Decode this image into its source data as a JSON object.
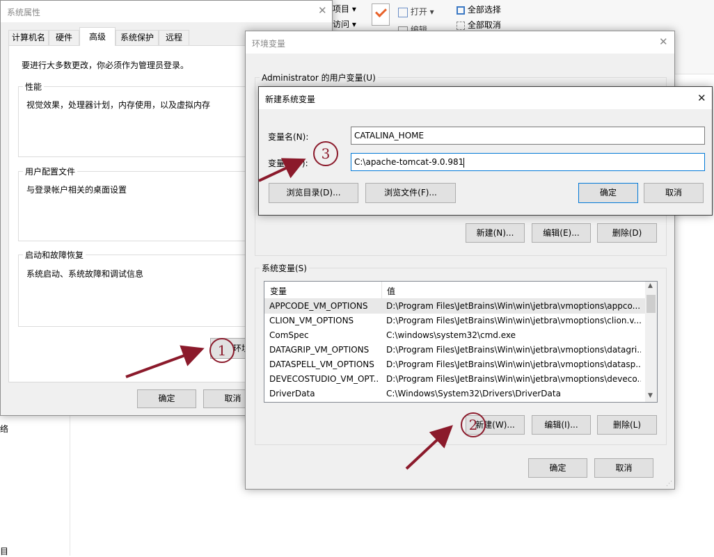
{
  "explorer": {
    "ribbon": {
      "item_project": "项目",
      "item_access": "访问",
      "open": "打开",
      "edit": "编辑",
      "select_all": "全部选择",
      "select_none": "全部取消"
    },
    "left_text_1": "络",
    "left_text_2": "目"
  },
  "sys_props": {
    "title": "系统属性",
    "tabs": [
      "计算机名",
      "硬件",
      "高级",
      "系统保护",
      "远程"
    ],
    "admin_note": "要进行大多数更改，你必须作为管理员登录。",
    "groups": [
      {
        "label": "性能",
        "desc": "视觉效果，处理器计划，内存使用，以及虚拟内存"
      },
      {
        "label": "用户配置文件",
        "desc": "与登录帐户相关的桌面设置"
      },
      {
        "label": "启动和故障恢复",
        "desc": "系统启动、系统故障和调试信息"
      }
    ],
    "env_button": "环境",
    "ok": "确定",
    "cancel": "取消"
  },
  "env_vars": {
    "title": "环境变量",
    "user_group_label": "Administrator 的用户变量(U)",
    "user_buttons": {
      "new": "新建(N)...",
      "edit": "编辑(E)...",
      "delete": "删除(D)"
    },
    "sys_group_label": "系统变量(S)",
    "columns": {
      "name": "变量",
      "value": "值"
    },
    "rows": [
      {
        "name": "APPCODE_VM_OPTIONS",
        "value": "D:\\Program Files\\JetBrains\\Win\\win\\jetbra\\vmoptions\\appco..."
      },
      {
        "name": "CLION_VM_OPTIONS",
        "value": "D:\\Program Files\\JetBrains\\Win\\win\\jetbra\\vmoptions\\clion.v..."
      },
      {
        "name": "ComSpec",
        "value": "C:\\windows\\system32\\cmd.exe"
      },
      {
        "name": "DATAGRIP_VM_OPTIONS",
        "value": "D:\\Program Files\\JetBrains\\Win\\win\\jetbra\\vmoptions\\datagri..."
      },
      {
        "name": "DATASPELL_VM_OPTIONS",
        "value": "D:\\Program Files\\JetBrains\\Win\\win\\jetbra\\vmoptions\\datasp..."
      },
      {
        "name": "DEVECOSTUDIO_VM_OPT...",
        "value": "D:\\Program Files\\JetBrains\\Win\\win\\jetbra\\vmoptions\\deveco..."
      },
      {
        "name": "DriverData",
        "value": "C:\\Windows\\System32\\Drivers\\DriverData"
      }
    ],
    "sys_buttons": {
      "new": "新建(W)...",
      "edit": "编辑(I)...",
      "delete": "删除(L)"
    },
    "ok": "确定",
    "cancel": "取消"
  },
  "new_var": {
    "title": "新建系统变量",
    "name_label": "变量名(N):",
    "name_value": "CATALINA_HOME",
    "value_label": "变量值(V):",
    "value_value": "C:\\apache-tomcat-9.0.981",
    "browse_dir": "浏览目录(D)...",
    "browse_file": "浏览文件(F)...",
    "ok": "确定",
    "cancel": "取消"
  },
  "annotations": {
    "step1": "1",
    "step2": "2",
    "step3": "3",
    "arrow_color": "#8b1a2b"
  }
}
